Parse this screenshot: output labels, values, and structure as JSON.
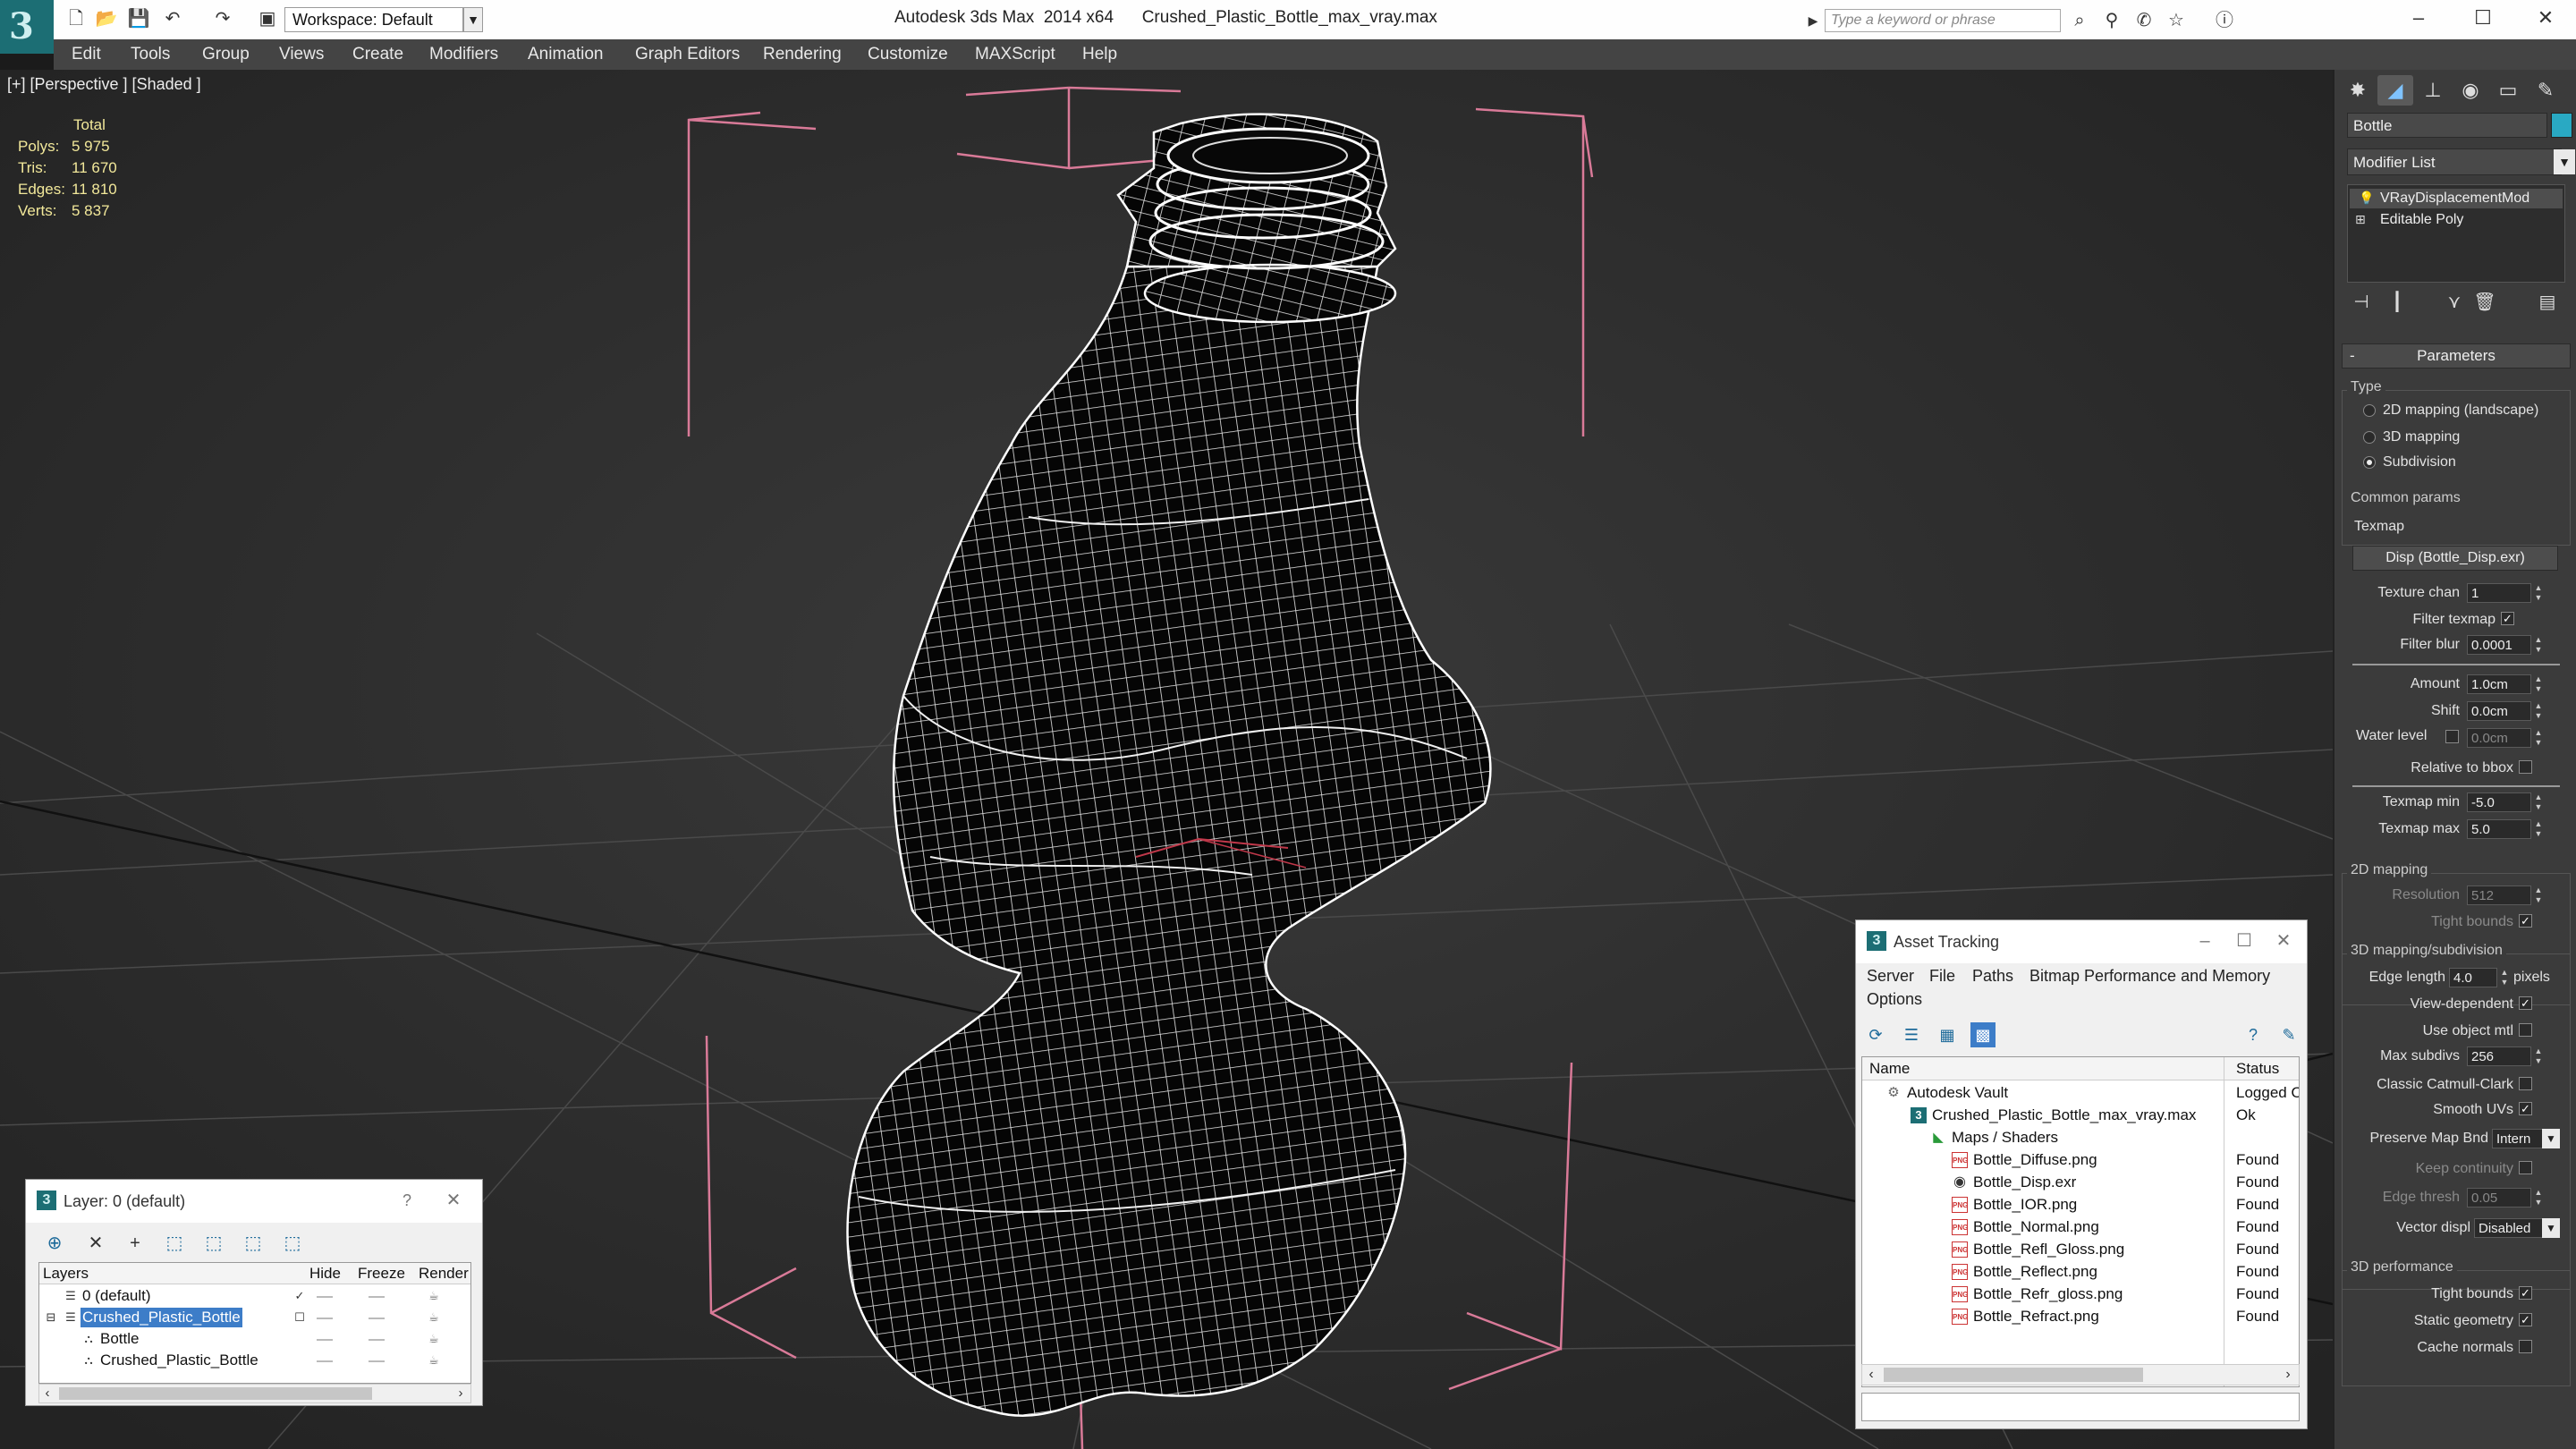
{
  "title_bar": {
    "app_title": "Autodesk 3ds Max  2014 x64      Crushed_Plastic_Bottle_max_vray.max",
    "workspace": "Workspace: Default",
    "search_placeholder": "Type a keyword or phrase"
  },
  "menu": [
    "Edit",
    "Tools",
    "Group",
    "Views",
    "Create",
    "Modifiers",
    "Animation",
    "Graph Editors",
    "Rendering",
    "Customize",
    "MAXScript",
    "Help"
  ],
  "viewport": {
    "label": "[+] [Perspective ] [Shaded ]",
    "stats": {
      "header": "Total",
      "rows": [
        {
          "k": "Polys:",
          "v": "5 975"
        },
        {
          "k": "Tris:",
          "v": "11 670"
        },
        {
          "k": "Edges:",
          "v": "11 810"
        },
        {
          "k": "Verts:",
          "v": "5 837"
        }
      ]
    }
  },
  "command_panel": {
    "object_name": "Bottle",
    "object_color": "#29a9c3",
    "modifier_list": "Modifier List",
    "stack": [
      "VRayDisplacementMod",
      "Editable Poly"
    ],
    "rollout": "Parameters",
    "type_group": "Type",
    "type_options": [
      "2D mapping (landscape)",
      "3D mapping",
      "Subdivision"
    ],
    "common_group": "Common params",
    "texmap_label": "Texmap",
    "texmap_button": "Disp (Bottle_Disp.exr)",
    "texture_chan_label": "Texture chan",
    "texture_chan_value": "1",
    "filter_texmap_label": "Filter texmap",
    "filter_blur_label": "Filter blur",
    "filter_blur_value": "0.0001",
    "amount_label": "Amount",
    "amount_value": "1.0cm",
    "shift_label": "Shift",
    "shift_value": "0.0cm",
    "water_level_label": "Water level",
    "water_level_value": "0.0cm",
    "relative_bbox_label": "Relative to bbox",
    "texmap_min_label": "Texmap min",
    "texmap_min_value": "-5.0",
    "texmap_max_label": "Texmap max",
    "texmap_max_value": "5.0",
    "mapping2d_group": "2D mapping",
    "resolution_label": "Resolution",
    "resolution_value": "512",
    "tight_bounds_label": "Tight bounds",
    "mapping3d_group": "3D mapping/subdivision",
    "edge_length_label": "Edge length",
    "edge_length_value": "4.0",
    "pixels_label": "pixels",
    "view_dependent_label": "View-dependent",
    "use_object_mtl_label": "Use object mtl",
    "max_subdivs_label": "Max subdivs",
    "max_subdivs_value": "256",
    "classic_catmull_label": "Classic Catmull-Clark",
    "smooth_uvs_label": "Smooth UVs",
    "preserve_map_label": "Preserve Map Bnd",
    "preserve_map_value": "Intern",
    "keep_continuity_label": "Keep continuity",
    "edge_thresh_label": "Edge thresh",
    "edge_thresh_value": "0.05",
    "vector_displ_label": "Vector displ",
    "vector_displ_value": "Disabled",
    "perf_group": "3D performance",
    "perf_tight_bounds_label": "Tight bounds",
    "static_geometry_label": "Static geometry",
    "cache_normals_label": "Cache normals"
  },
  "asset_tracking": {
    "title": "Asset Tracking",
    "menu": [
      "Server",
      "File",
      "Paths",
      "Bitmap Performance and Memory",
      "Options"
    ],
    "col_name": "Name",
    "col_status": "Status",
    "rows": [
      {
        "name": "Autodesk Vault",
        "status": "Logged O",
        "icon": "vault"
      },
      {
        "name": "Crushed_Plastic_Bottle_max_vray.max",
        "status": "Ok",
        "icon": "max"
      },
      {
        "name": "Maps / Shaders",
        "status": "",
        "icon": "folder"
      },
      {
        "name": "Bottle_Diffuse.png",
        "status": "Found",
        "icon": "png"
      },
      {
        "name": "Bottle_Disp.exr",
        "status": "Found",
        "icon": "exr"
      },
      {
        "name": "Bottle_IOR.png",
        "status": "Found",
        "icon": "png"
      },
      {
        "name": "Bottle_Normal.png",
        "status": "Found",
        "icon": "png"
      },
      {
        "name": "Bottle_Refl_Gloss.png",
        "status": "Found",
        "icon": "png"
      },
      {
        "name": "Bottle_Reflect.png",
        "status": "Found",
        "icon": "png"
      },
      {
        "name": "Bottle_Refr_gloss.png",
        "status": "Found",
        "icon": "png"
      },
      {
        "name": "Bottle_Refract.png",
        "status": "Found",
        "icon": "png"
      }
    ]
  },
  "layers": {
    "title": "Layer: 0 (default)",
    "help": "?",
    "col_layers": "Layers",
    "col_hide": "Hide",
    "col_freeze": "Freeze",
    "col_render": "Render",
    "rows": [
      {
        "name": "0 (default)"
      },
      {
        "name": "Crushed_Plastic_Bottle"
      },
      {
        "name": "Bottle"
      },
      {
        "name": "Crushed_Plastic_Bottle"
      }
    ]
  }
}
